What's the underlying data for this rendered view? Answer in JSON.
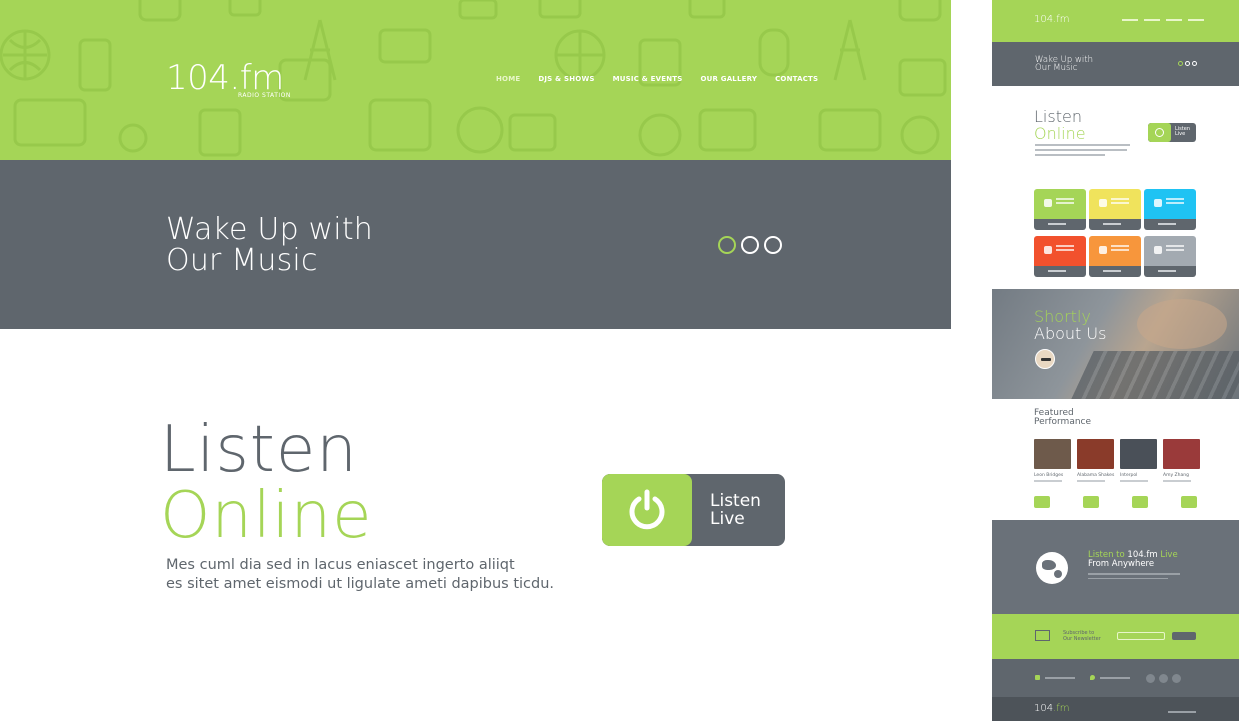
{
  "colors": {
    "accent": "#a5d557",
    "slate": "#5f666d",
    "white": "#ffffff"
  },
  "brand": {
    "logo_main": "104",
    "logo_dot": ".fm",
    "logo_sub": "RADIO STATION"
  },
  "nav": {
    "items": [
      {
        "label": "HOME",
        "active": true
      },
      {
        "label": "DJS & SHOWS",
        "active": false
      },
      {
        "label": "MUSIC & EVENTS",
        "active": false
      },
      {
        "label": "OUR GALLERY",
        "active": false
      },
      {
        "label": "CONTACTS",
        "active": false
      }
    ]
  },
  "slider": {
    "line1": "Wake Up with",
    "line2": "Our Music",
    "dots": 3,
    "active_dot": 1
  },
  "listen": {
    "title_line1": "Listen",
    "title_line2": "Online",
    "desc_line1": "Mes cuml dia sed in lacus eniascet ingerto aliiqt",
    "desc_line2": "es sitet amet eismodi ut ligulate ameti dapibus ticdu.",
    "button_line1": "Listen",
    "button_line2": "Live",
    "button_icon": "power-icon"
  },
  "thumbnail": {
    "logo": "104.fm",
    "slider_line1": "Wake Up with",
    "slider_line2": "Our Music",
    "listen_line1": "Listen",
    "listen_line2": "Online",
    "listen_btn_line1": "Listen",
    "listen_btn_line2": "Live",
    "tiles": [
      {
        "color": "#a5d557",
        "icon": "play-icon"
      },
      {
        "color": "#f0e35c",
        "icon": "facebook-icon"
      },
      {
        "color": "#1fc3f3",
        "icon": "news-icon"
      },
      {
        "color": "#f2512d",
        "icon": "phone-icon"
      },
      {
        "color": "#f7963c",
        "icon": "group-icon"
      },
      {
        "color": "#a3aab1",
        "icon": "share-icon"
      }
    ],
    "about_line1": "Shortly",
    "about_line2": "About Us",
    "featured_line1": "Featured",
    "featured_line2": "Performance",
    "performers": [
      {
        "name": "Leon Bridges",
        "color": "#6e5a4b"
      },
      {
        "name": "Alabama Shakes",
        "color": "#8a3b2a"
      },
      {
        "name": "Interpol",
        "color": "#4a5058"
      },
      {
        "name": "Amy Zhang",
        "color": "#9a3a3a"
      }
    ],
    "world_pre": "Listen to ",
    "world_brand": "104.fm",
    "world_post": " Live",
    "world_line2": "From Anywhere",
    "subscribe_line1": "Subscribe to",
    "subscribe_line2": "Our Newsletter",
    "bottom_logo_a": "104",
    "bottom_logo_b": ".fm"
  }
}
